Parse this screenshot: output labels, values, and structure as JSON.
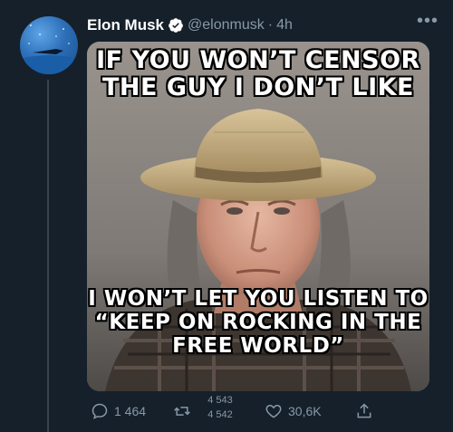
{
  "author": {
    "display_name": "Elon Musk",
    "handle": "@elonmusk",
    "separator": "·",
    "timestamp": "4h",
    "verified": true
  },
  "media": {
    "top_text": "IF YOU WON’T CENSOR\nTHE GUY I DON’T LIKE",
    "bottom_text": "I WON’T LET YOU LISTEN TO\n“KEEP ON ROCKING IN THE\nFREE WORLD”"
  },
  "actions": {
    "reply_count": "1 464",
    "retweet_count_old": "4 543",
    "retweet_count_new": "4 542",
    "like_count": "30,6K"
  },
  "icons": {
    "more": "more-horizontal-icon",
    "verified": "verified-badge-icon",
    "reply": "reply-icon",
    "retweet": "retweet-icon",
    "like": "heart-icon",
    "share": "share-icon"
  },
  "colors": {
    "background": "#15202b",
    "muted_text": "#8899a6",
    "verified_blue": "#1da1f2"
  }
}
